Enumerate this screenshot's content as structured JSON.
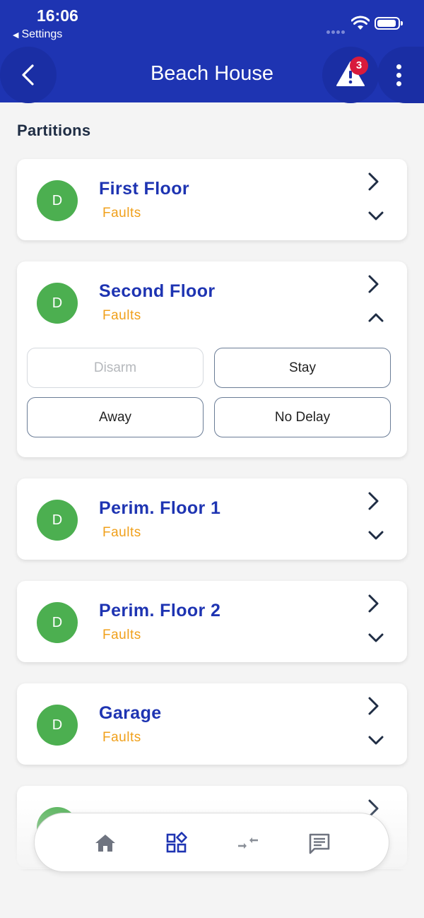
{
  "status_bar": {
    "time": "16:06",
    "back_app": "Settings"
  },
  "header": {
    "title": "Beach House",
    "alert_count": "3"
  },
  "section": {
    "title": "Partitions"
  },
  "partitions": [
    {
      "avatar": "D",
      "name": "First Floor",
      "status": "Faults",
      "expanded": false
    },
    {
      "avatar": "D",
      "name": "Second Floor",
      "status": "Faults",
      "expanded": true
    },
    {
      "avatar": "D",
      "name": "Perim. Floor 1",
      "status": "Faults",
      "expanded": false
    },
    {
      "avatar": "D",
      "name": "Perim. Floor 2",
      "status": "Faults",
      "expanded": false
    },
    {
      "avatar": "D",
      "name": "Garage",
      "status": "Faults",
      "expanded": false
    }
  ],
  "arm_modes": {
    "disarm": "Disarm",
    "stay": "Stay",
    "away": "Away",
    "no_delay": "No Delay"
  },
  "bottom_nav": [
    "home-icon",
    "dashboard-icon",
    "transfer-icon",
    "messages-icon"
  ],
  "colors": {
    "primary": "#1e34b2",
    "status_ok": "#4caf50",
    "faults": "#f0a01b",
    "badge": "#d81b3c"
  }
}
